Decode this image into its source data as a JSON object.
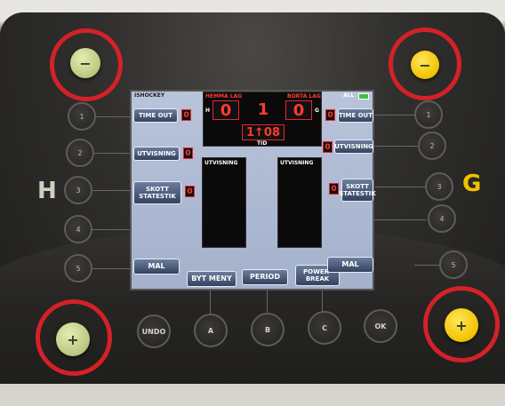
{
  "screen": {
    "sport_label": "ISHOCKEY",
    "all_label": "ALL",
    "home_team_label": "HEMMA LAG",
    "away_team_label": "BORTA LAG",
    "home_score": "0",
    "away_score": "0",
    "period": "1",
    "home_marker": "H",
    "away_marker": "G",
    "time_value": "1↑08",
    "time_label": "TID",
    "home_timeout_label": "TIME OUT",
    "home_timeout_count": "0",
    "away_timeout_label": "TIME OUT",
    "away_timeout_count": "0",
    "home_penalty_label": "UTVISNING",
    "home_penalty_count": "0",
    "away_penalty_label": "UTVISNING",
    "away_penalty_count": "0",
    "home_shots_label": "SKOTT STATESTIK",
    "home_shots_count": "0",
    "away_shots_label": "SKOTT STATESTIK",
    "away_shots_count": "0",
    "home_penalty_panel_title": "UTVISNING",
    "away_penalty_panel_title": "UTVISNING",
    "home_goal_label": "MAL",
    "away_goal_label": "MAL",
    "change_menu_label": "BYT MENY",
    "period_button_label": "PERIOD",
    "power_break_label": "POWER-\nBREAK"
  },
  "device": {
    "home_side_letter": "H",
    "away_side_letter": "G",
    "home_minus": "−",
    "away_minus": "−",
    "home_plus": "+",
    "away_plus": "+",
    "left_buttons": [
      "1",
      "2",
      "3",
      "4",
      "5"
    ],
    "right_buttons": [
      "1",
      "2",
      "3",
      "4",
      "5"
    ],
    "bottom_buttons": [
      "UNDO",
      "A",
      "B",
      "C",
      "OK"
    ]
  },
  "colors": {
    "highlight_ring": "#d42127",
    "home_button": "#c4d28a",
    "away_button": "#f2c200",
    "screen_digits": "#ff3b2e"
  }
}
